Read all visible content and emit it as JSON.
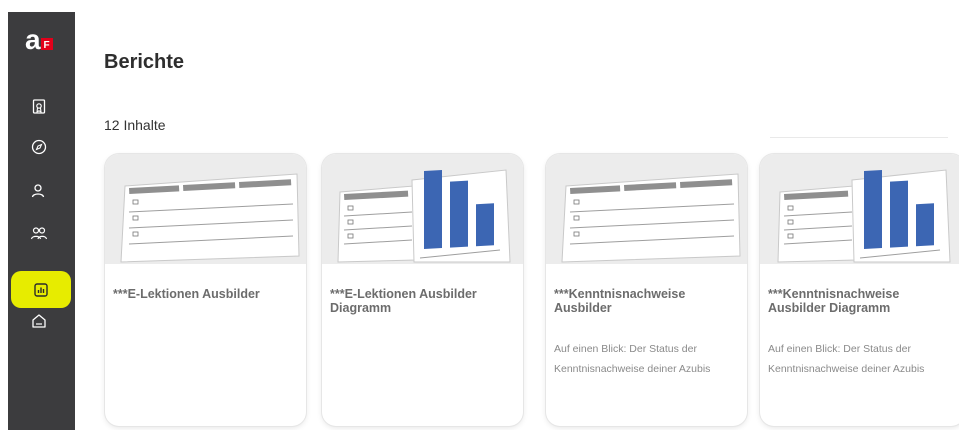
{
  "sidebar": {
    "logo_name": "af-logo",
    "accent_color": "#e7ec00",
    "items": [
      {
        "icon": "certificate-icon",
        "active": false
      },
      {
        "icon": "compass-icon",
        "active": false
      },
      {
        "icon": "user-icon",
        "active": false
      },
      {
        "icon": "users-icon",
        "active": false
      },
      {
        "icon": "report-chart-icon",
        "active": true
      },
      {
        "icon": "home-icon",
        "active": false
      }
    ]
  },
  "page": {
    "title": "Berichte",
    "count_label": "12 Inhalte"
  },
  "cards": [
    {
      "title": "***E-Lektionen Ausbilder",
      "description": "",
      "thumbnail": "table-thumbnail"
    },
    {
      "title": "***E-Lektionen Ausbilder Diagramm",
      "description": "",
      "thumbnail": "chart-thumbnail"
    },
    {
      "title": "***Kenntnisnachweise Ausbilder",
      "description": "Auf einen Blick: Der Status der Kenntnisnachweise deiner Azubis",
      "thumbnail": "table-thumbnail"
    },
    {
      "title": "***Kenntnisnachweise Ausbilder Diagramm",
      "description": "Auf einen Blick: Der Status der Kenntnisnachweise deiner Azubis",
      "thumbnail": "chart-thumbnail"
    }
  ]
}
